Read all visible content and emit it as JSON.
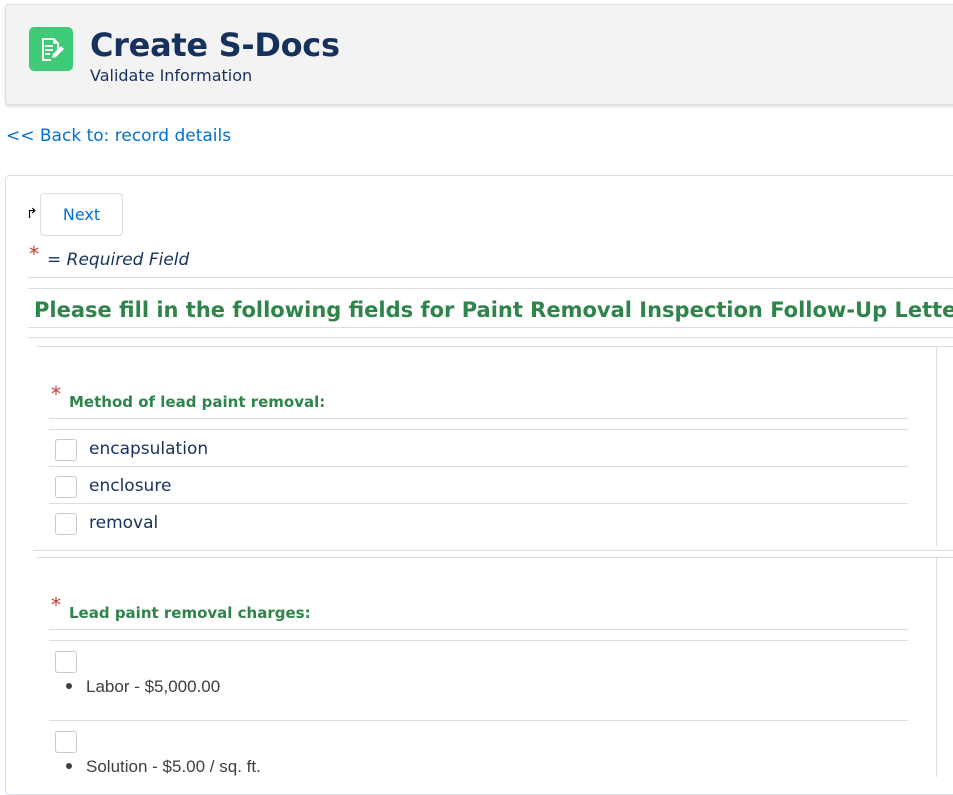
{
  "header": {
    "title": "Create S-Docs",
    "subtitle": "Validate Information",
    "icon": "document-edit-icon",
    "icon_color": "#3fcb76"
  },
  "nav": {
    "back_link": "<< Back to: record details"
  },
  "form": {
    "next_label": "Next",
    "required_star": "*",
    "required_legend": "= Required Field",
    "heading": "Please fill in the following fields for Paint Removal Inspection Follow-Up Letter",
    "fields": [
      {
        "label": "Method of lead paint removal:",
        "options": [
          "encapsulation",
          "enclosure",
          "removal"
        ]
      },
      {
        "label": "Lead paint removal charges:",
        "options": [
          "Labor - $5,000.00",
          "Solution - $5.00 / sq. ft."
        ]
      }
    ]
  },
  "colors": {
    "accent_green": "#2e844a",
    "link_blue": "#0070d2",
    "required_red": "#c23934"
  }
}
